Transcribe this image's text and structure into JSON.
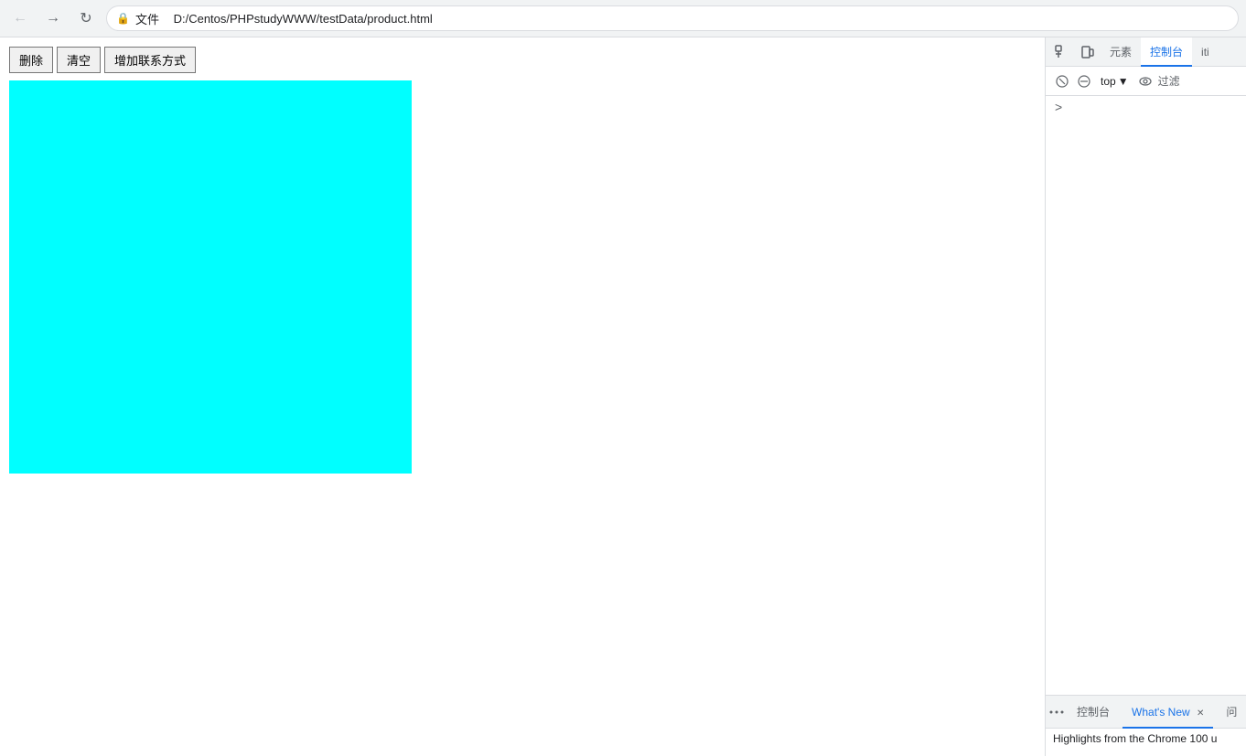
{
  "browser": {
    "url": "D:/Centos/PHPstudyWWW/testData/product.html",
    "url_prefix": "文件",
    "back_btn": "←",
    "forward_btn": "→",
    "refresh_btn": "↻"
  },
  "page": {
    "btn_delete": "删除",
    "btn_clear": "清空",
    "btn_add": "增加联系方式",
    "cyan_box_color": "#00ffff"
  },
  "devtools": {
    "tabs": [
      {
        "label": "元素",
        "active": false
      },
      {
        "label": "控制台",
        "active": true
      },
      {
        "label": "iti",
        "active": false
      }
    ],
    "secondary": {
      "top_label": "top",
      "filter_label": "过滤"
    },
    "console_symbol": ">",
    "bottom_tabs": [
      {
        "label": "控制台",
        "active": false
      },
      {
        "label": "What's New",
        "active": true
      },
      {
        "label": "问",
        "active": false
      }
    ],
    "bottom_content": "Highlights from the Chrome 100 u"
  }
}
